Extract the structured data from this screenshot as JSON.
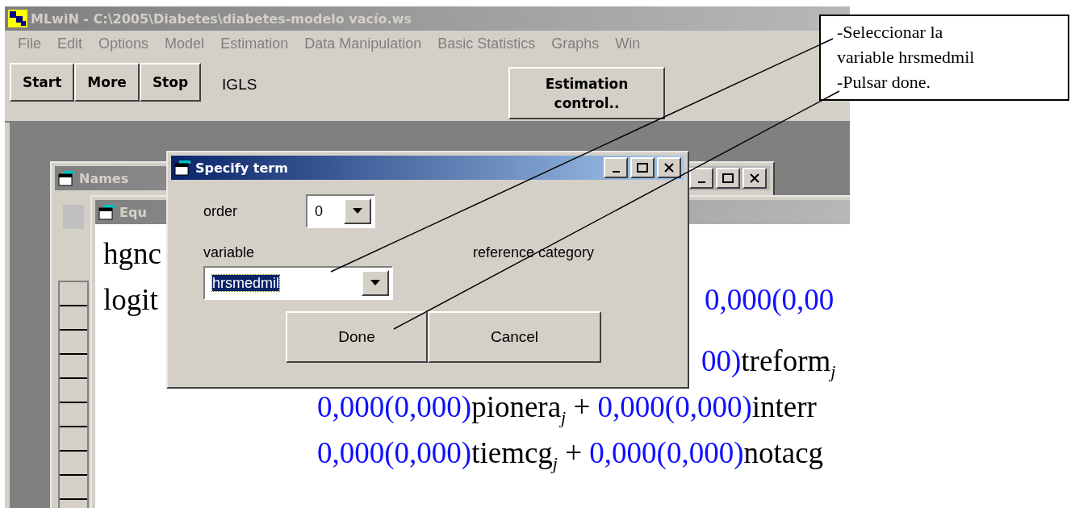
{
  "main_window": {
    "title": "MLwiN - C:\\2005\\Diabetes\\diabetes-modelo vacío.ws",
    "active": false
  },
  "menu": [
    "File",
    "Edit",
    "Options",
    "Model",
    "Estimation",
    "Data Manipulation",
    "Basic Statistics",
    "Graphs",
    "Win"
  ],
  "toolbar": {
    "buttons": [
      "Start",
      "More",
      "Stop"
    ],
    "method": "IGLS",
    "estimation_button": "Estimation control.."
  },
  "names_window": {
    "title": "Names",
    "active": false
  },
  "equations_window": {
    "title": "Equ",
    "active": false,
    "lines": [
      {
        "kind": "head",
        "lead": "hgnc"
      },
      {
        "kind": "head",
        "lead": "logit",
        "segments": [
          {
            "kind": "coef",
            "text": "0,000(0,00"
          }
        ]
      },
      {
        "kind": "tail",
        "segments": [
          {
            "kind": "coef",
            "text": "00)"
          },
          {
            "kind": "var",
            "text": "treform"
          },
          {
            "kind": "sub",
            "text": "j"
          }
        ]
      },
      {
        "kind": "body",
        "segments": [
          {
            "kind": "coef",
            "text": "0,000(0,000)"
          },
          {
            "kind": "var",
            "text": "pionera"
          },
          {
            "kind": "sub",
            "text": "j"
          },
          {
            "kind": "var",
            "text": " + "
          },
          {
            "kind": "coef",
            "text": "0,000(0,000)"
          },
          {
            "kind": "var",
            "text": "interr"
          }
        ]
      },
      {
        "kind": "body",
        "segments": [
          {
            "kind": "coef",
            "text": "0,000(0,000)"
          },
          {
            "kind": "var",
            "text": "tiemcg"
          },
          {
            "kind": "sub",
            "text": "j"
          },
          {
            "kind": "var",
            "text": " + "
          },
          {
            "kind": "coef",
            "text": "0,000(0,000)"
          },
          {
            "kind": "var",
            "text": "notacg"
          }
        ]
      }
    ]
  },
  "dialog": {
    "title": "Specify term",
    "active": true,
    "fields": [
      {
        "label": "order",
        "value": "0",
        "highlighted": false
      },
      {
        "label": "variable",
        "value": "hrsmedmil",
        "highlighted": true
      }
    ],
    "reference_label": "reference category",
    "buttons": [
      "Done",
      "Cancel"
    ]
  },
  "callout": {
    "lines": [
      "-Seleccionar la",
      "variable hrsmedmil",
      "-Pulsar done."
    ]
  }
}
